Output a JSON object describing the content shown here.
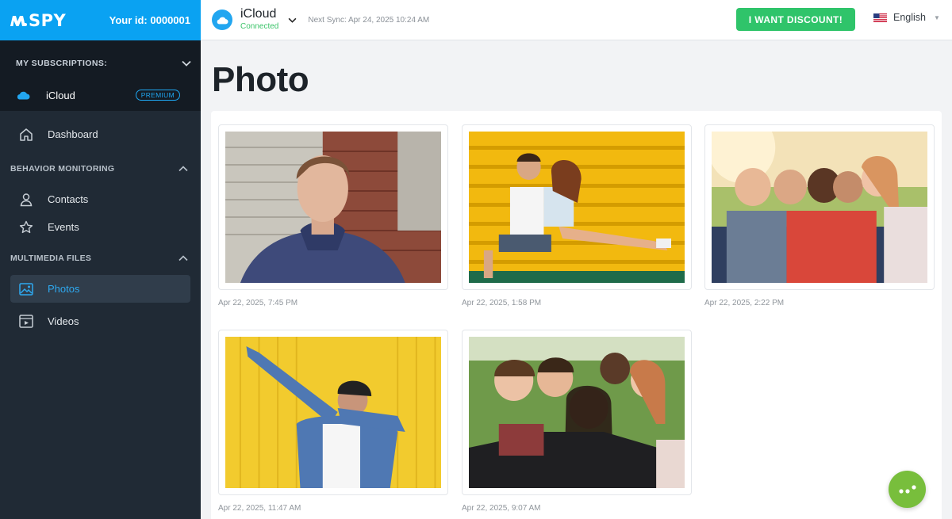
{
  "brand": {
    "logo_text": "SPY",
    "user_id_label": "Your id: 0000001"
  },
  "subscriptions": {
    "heading": "MY SUBSCRIPTIONS:",
    "item": {
      "name": "iCloud",
      "badge": "PREMIUM"
    }
  },
  "nav": {
    "dashboard": "Dashboard",
    "behavior_heading": "BEHAVIOR MONITORING",
    "contacts": "Contacts",
    "events": "Events",
    "multimedia_heading": "MULTIMEDIA FILES",
    "photos": "Photos",
    "videos": "Videos"
  },
  "topbar": {
    "account_name": "iCloud",
    "account_status": "Connected",
    "sync_text": "Next Sync: Apr 24, 2025 10:24 AM",
    "discount_button": "I WANT DISCOUNT!",
    "language": "English"
  },
  "page": {
    "title": "Photo"
  },
  "photos": [
    {
      "date": "Apr 22, 2025, 7:45 PM",
      "subject": "young man in hoodie by brick wall"
    },
    {
      "date": "Apr 22, 2025, 1:58 PM",
      "subject": "couple on yellow bleachers"
    },
    {
      "date": "Apr 22, 2025, 2:22 PM",
      "subject": "group of friends selfie in sunlight"
    },
    {
      "date": "Apr 22, 2025, 11:47 AM",
      "subject": "man dabbing against yellow wall"
    },
    {
      "date": "Apr 22, 2025, 9:07 AM",
      "subject": "group of friends selfie in park"
    }
  ],
  "colors": {
    "accent": "#0aa2f2",
    "sidebar": "#202a35",
    "success": "#2fc46a",
    "fab": "#78be3c"
  }
}
